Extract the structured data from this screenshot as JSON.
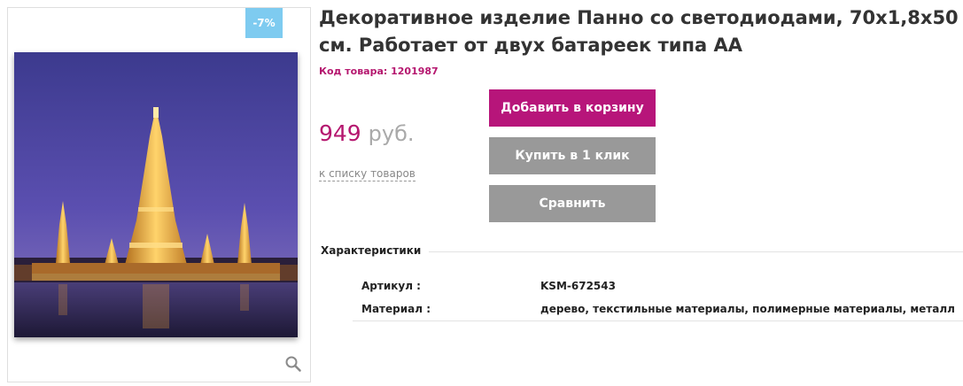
{
  "product": {
    "title": "Декоративное изделие Панно со светодиодами, 70х1,8х50 см. Работает от двух батареек типа АА",
    "sku_label": "Код товара:",
    "sku_value": "1201987",
    "discount_badge": "-7%",
    "price_value": "949",
    "price_currency": "руб.",
    "back_link": "к списку товаров"
  },
  "buttons": {
    "add_to_cart": "Добавить в корзину",
    "buy_one_click": "Купить в 1 клик",
    "compare": "Сравнить"
  },
  "specs": {
    "heading": "Характеристики",
    "rows": [
      {
        "key": "Артикул :",
        "value": "KSM-672543"
      },
      {
        "key": "Материал :",
        "value": "дерево, текстильные материалы, полимерные материалы, металл"
      }
    ]
  },
  "icons": {
    "zoom": "magnifier-icon"
  },
  "colors": {
    "accent": "#b7157a",
    "badge": "#7ecbf0",
    "secondary_button": "#999999"
  }
}
